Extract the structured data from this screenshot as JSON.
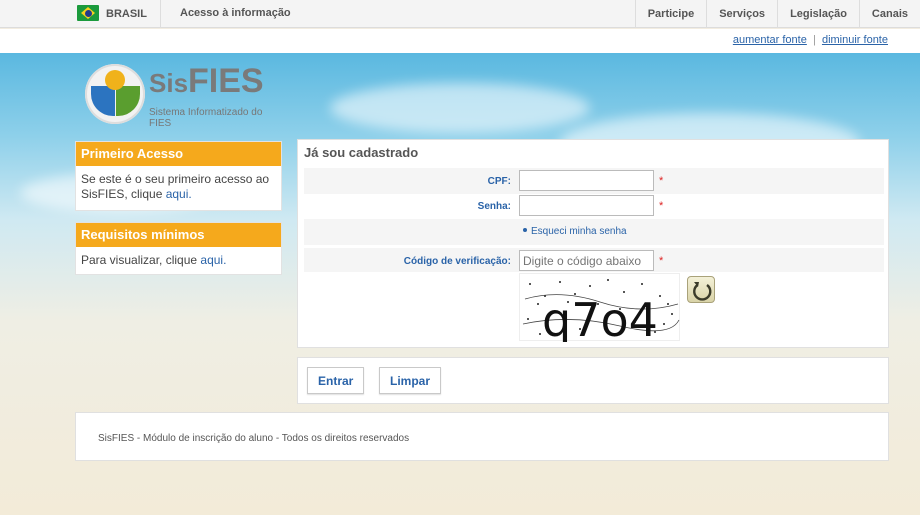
{
  "govbar": {
    "country": "BRASIL",
    "access_info": "Acesso à informação",
    "nav": [
      "Participe",
      "Serviços",
      "Legislação",
      "Canais"
    ]
  },
  "fontbar": {
    "increase": "aumentar fonte",
    "decrease": "diminuir fonte"
  },
  "logo": {
    "prefix": "Sis",
    "name": "FIES",
    "subtitle": "Sistema Informatizado do FIES"
  },
  "sidebar": {
    "first_access": {
      "title": "Primeiro Acesso",
      "text": "Se este é o seu primeiro acesso ao SisFIES, clique ",
      "link": "aqui."
    },
    "requirements": {
      "title": "Requisitos mínimos",
      "text": "Para visualizar, clique ",
      "link": "aqui."
    }
  },
  "form": {
    "title": "Já sou cadastrado",
    "cpf_label": "CPF:",
    "cpf_value": "",
    "password_label": "Senha:",
    "password_value": "",
    "forgot_password": "Esqueci minha senha",
    "code_label": "Código de verificação:",
    "code_placeholder": "Digite o código abaixo",
    "required_mark": "*",
    "captcha_text": "q7o4",
    "refresh_icon": "refresh-icon"
  },
  "buttons": {
    "enter": "Entrar",
    "clear": "Limpar"
  },
  "footer": {
    "text": "SisFIES - Módulo de inscrição do aluno - Todos os direitos reservados"
  },
  "colors": {
    "accent": "#f5a91c",
    "link": "#2a63a8",
    "required": "#dd2222"
  }
}
